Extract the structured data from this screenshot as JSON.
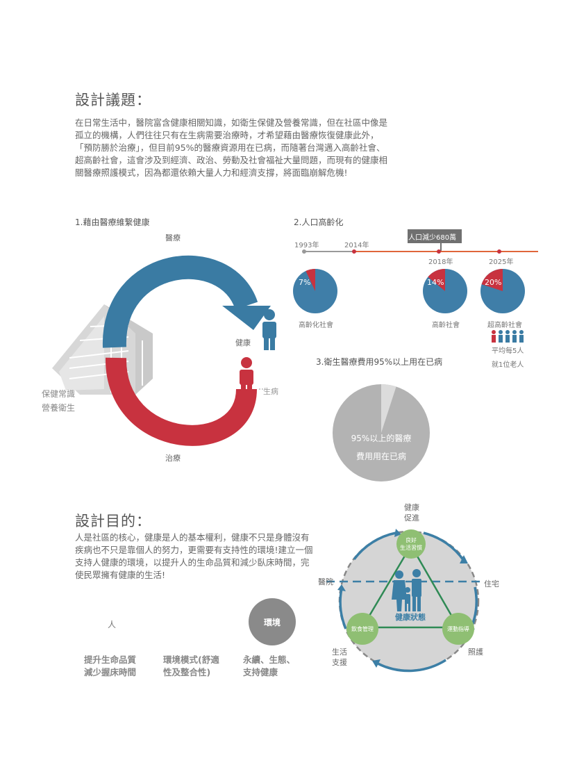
{
  "issues": {
    "title": "設計議題：",
    "paragraph": "在日常生活中，醫院富含健康相關知識，如衛生保健及營養常識，但在社區中像是孤立的機構，人們往往只有在生病需要治療時，才希望藉由醫療恢復健康此外，「預防勝於治療」，但目前95%的醫療資源用在已病，而隨著台灣邁入高齡社會、超高齡社會，這會涉及到經濟、政治、勞動及社會福祉大量問題，而現有的健康相關醫療照護模式，因為都還依賴大量人力和經濟支撐，將面臨崩解危機!"
  },
  "diagram1": {
    "title": "1.藉由醫療維繫健康",
    "label_medical": "醫療",
    "label_health": "健康",
    "label_sick": "生病",
    "label_treatment": "治療",
    "label_care_1": "保健常識",
    "label_care_2": "營養衛生"
  },
  "diagram2": {
    "title": "2.人口高齡化",
    "callout": "人口減少680萬",
    "years": [
      "1993年",
      "2014年",
      "2018年",
      "2025年"
    ],
    "pies": [
      {
        "percent_label": "7%",
        "percent": 7,
        "caption": "高齡化社會"
      },
      {
        "percent_label": "14%",
        "percent": 14,
        "caption": "高齡社會"
      },
      {
        "percent_label": "20%",
        "percent": 20,
        "caption": "超高齡社會"
      }
    ],
    "note_1": "平均每5人",
    "note_2": "就1位老人",
    "colors": {
      "pie": "#3f7ea8",
      "slice": "#c8323f",
      "timeline_gray": "#999999",
      "timeline_orange": "#e0663a"
    }
  },
  "diagram3": {
    "title": "3.衛生醫療費用95%以上用在已病",
    "pie_text_1": "95%以上的醫療",
    "pie_text_2": "費用用在已病",
    "percent": 95
  },
  "purpose": {
    "title": "設計目的：",
    "paragraph": "人是社區的核心，健康是人的基本權利，健康不只是身體沒有疾病也不只是靠個人的努力，更需要有支持性的環境!建立一個支持人健康的環境，以提升人的生命品質和減少臥床時間，完使民眾擁有健康的生活!",
    "circle_person": "人",
    "circle_env": "環境",
    "col1": "提升生命品質\n減少握床時間",
    "col2": "環境模式(舒適\n性及整合性)",
    "col3": "永續、生態、\n支持健康"
  },
  "cycle": {
    "top_1": "健康",
    "top_2": "促進",
    "left": "醫院",
    "right": "住宅",
    "bottom_left_1": "生活",
    "bottom_left_2": "支援",
    "bottom_right": "照護",
    "node_top_1": "良好",
    "node_top_2": "生活習慣",
    "node_left": "飲食管理",
    "node_right": "運動指導",
    "center": "健康狀態",
    "colors": {
      "ring": "#3c7fa6",
      "node": "#8fbf73",
      "triangle": "#2f8a55",
      "bg": "#d5d5d5"
    }
  }
}
